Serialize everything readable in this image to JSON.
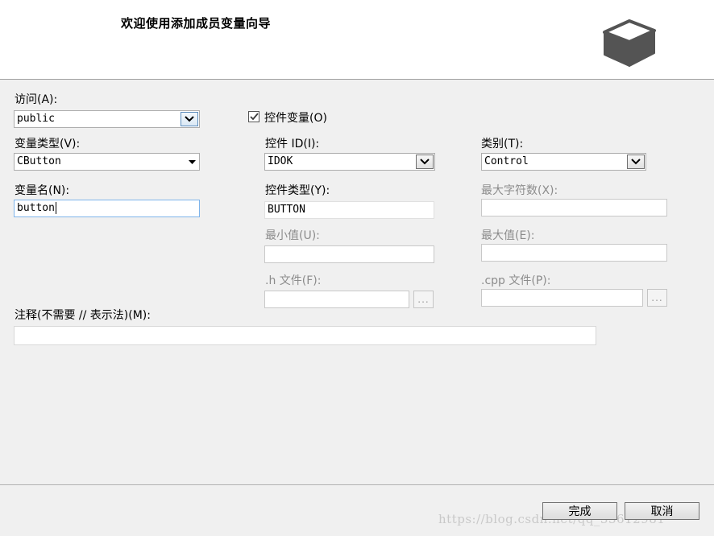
{
  "header": {
    "title": "欢迎使用添加成员变量向导",
    "logo_icon": "box-icon"
  },
  "access": {
    "label": "访问(A):",
    "value": "public"
  },
  "control_variable": {
    "label": "控件变量(O)",
    "checked": true
  },
  "variable_type": {
    "label": "变量类型(V):",
    "value": "CButton"
  },
  "control_id": {
    "label": "控件 ID(I):",
    "value": "IDOK"
  },
  "category": {
    "label": "类别(T):",
    "value": "Control"
  },
  "variable_name": {
    "label": "变量名(N):",
    "value": "button"
  },
  "control_type": {
    "label": "控件类型(Y):",
    "value": "BUTTON"
  },
  "max_chars": {
    "label": "最大字符数(X):",
    "value": ""
  },
  "min_value": {
    "label": "最小值(U):",
    "value": ""
  },
  "max_value": {
    "label": "最大值(E):",
    "value": ""
  },
  "h_file": {
    "label": ".h 文件(F):",
    "value": "",
    "browse_label": "..."
  },
  "cpp_file": {
    "label": ".cpp 文件(P):",
    "value": "",
    "browse_label": "..."
  },
  "comment": {
    "label": "注释(不需要 // 表示法)(M):",
    "value": ""
  },
  "footer": {
    "finish_label": "完成",
    "cancel_label": "取消",
    "watermark": "https://blog.csdn.net/qq_33612981"
  },
  "colors": {
    "accent_border": "#5c8dbd",
    "disabled_text": "#8c8c8c",
    "background": "#f0f0f0"
  }
}
